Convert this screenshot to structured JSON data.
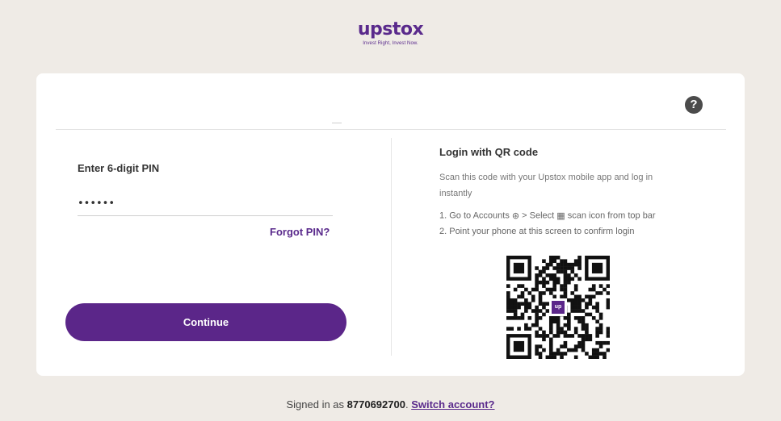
{
  "brand": {
    "name": "upstox",
    "tagline": "Invest Right, Invest Now.",
    "color": "#5a2a8c"
  },
  "pin_panel": {
    "label": "Enter 6-digit PIN",
    "pin_value": "••••••",
    "forgot_label": "Forgot PIN?",
    "continue_label": "Continue"
  },
  "qr_panel": {
    "title": "Login with QR code",
    "description": "Scan this code with your Upstox mobile app and log in instantly",
    "step1_prefix": "1. Go to Accounts",
    "step1_icon": "⊛",
    "step1_mid": " > Select ",
    "step1_icon2": "▦",
    "step1_suffix": " scan icon from top bar",
    "step2": "2. Point your phone at this screen to confirm login",
    "qr_logo_text": "up"
  },
  "help": {
    "icon": "?"
  },
  "footer": {
    "prefix": "Signed in as ",
    "phone": "8770692700",
    "separator": ". ",
    "switch_label": "Switch account?"
  }
}
